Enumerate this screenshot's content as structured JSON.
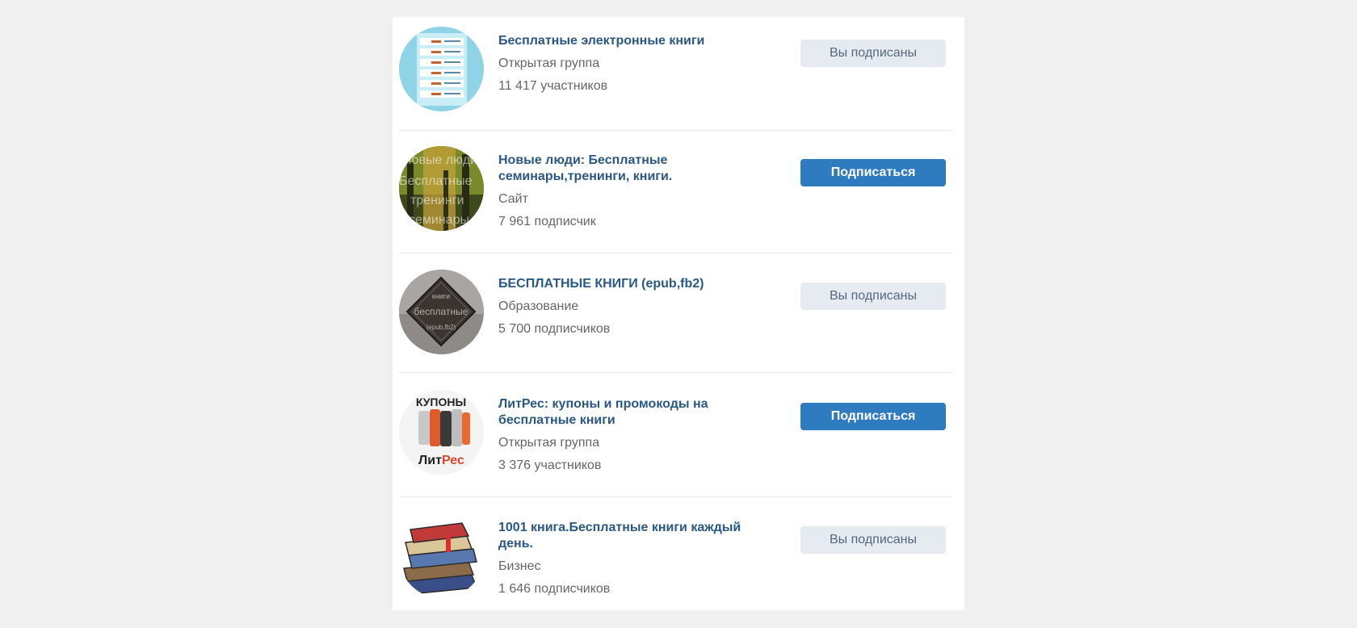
{
  "communities": [
    {
      "title": "Бесплатные электронные книги",
      "type": "Открытая группа",
      "members": "11 417 участников",
      "button": "Вы подписаны",
      "subscribed": true,
      "avatar_icon": "ebook-list-avatar"
    },
    {
      "title": "Новые люди: Бесплатные семинары,тренинги, книги.",
      "type": "Сайт",
      "members": "7 961 подписчик",
      "button": "Подписаться",
      "subscribed": false,
      "avatar_icon": "forest-avatar"
    },
    {
      "title": "БЕСПЛАТНЫЕ КНИГИ (epub,fb2)",
      "type": "Образование",
      "members": "5 700 подписчиков",
      "button": "Вы подписаны",
      "subscribed": true,
      "avatar_icon": "diamond-logo-avatar"
    },
    {
      "title": "ЛитРес: купоны и промокоды на бесплатные книги",
      "type": "Открытая группа",
      "members": "3 376 участников",
      "button": "Подписаться",
      "subscribed": false,
      "avatar_icon": "litres-books-avatar"
    },
    {
      "title": "1001 книга.Бесплатные книги каждый день.",
      "type": "Бизнес",
      "members": "1 646 подписчиков",
      "button": "Вы подписаны",
      "subscribed": true,
      "avatar_icon": "book-stack-avatar"
    }
  ],
  "avatar_text": {
    "litres_top": "КУПОНЫ",
    "litres_brand_a": "Лит",
    "litres_brand_b": "Рес"
  },
  "colors": {
    "link": "#2a5885",
    "subscribe_bg": "#2f7bbf",
    "subscribed_bg": "#e5ebf1"
  }
}
